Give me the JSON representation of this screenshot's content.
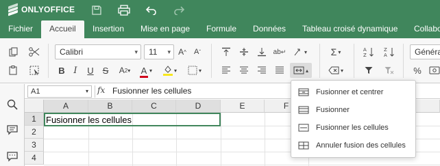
{
  "app": {
    "brand": "ONLYOFFICE",
    "accent": "#40865c"
  },
  "tabs": [
    "Fichier",
    "Accueil",
    "Insertion",
    "Mise en page",
    "Formule",
    "Données",
    "Tableau croisé dynamique",
    "Collabo"
  ],
  "ribbon": {
    "font_name": "Calibri",
    "font_size": "11",
    "number_format": "Général",
    "percent_symbol": "%"
  },
  "formula_bar": {
    "name_box": "A1",
    "fx": "fx",
    "content": "Fusionner les cellules"
  },
  "sheet": {
    "columns": [
      "A",
      "B",
      "C",
      "D",
      "E",
      "F"
    ],
    "rows": [
      "1",
      "2",
      "3",
      "4"
    ],
    "a1_value": "Fusionner les cellules"
  },
  "merge_menu": {
    "items": [
      "Fusionner et centrer",
      "Fusionner",
      "Fusionner les cellules",
      "Annuler fusion des cellules"
    ]
  }
}
